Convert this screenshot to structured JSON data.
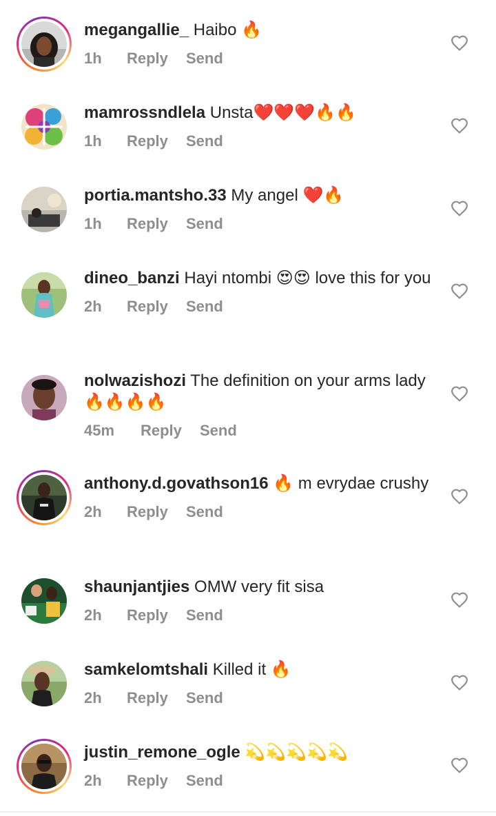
{
  "comments": [
    {
      "username": "megangallie_",
      "text": "Haibo 🔥",
      "time": "1h",
      "reply": "Reply",
      "send": "Send",
      "story_ring": true
    },
    {
      "username": "mamrossndlela",
      "text": "Unsta❤️❤️❤️🔥🔥",
      "time": "1h",
      "reply": "Reply",
      "send": "Send",
      "story_ring": false
    },
    {
      "username": "portia.mantsho.33",
      "text": "My angel ❤️🔥",
      "time": "1h",
      "reply": "Reply",
      "send": "Send",
      "story_ring": false
    },
    {
      "username": "dineo_banzi",
      "text": "Hayi ntombi 😍😍 love this for you",
      "time": "2h",
      "reply": "Reply",
      "send": "Send",
      "story_ring": false
    },
    {
      "username": "nolwazishozi",
      "text": "The definition on your arms lady🔥🔥🔥🔥",
      "time": "45m",
      "reply": "Reply",
      "send": "Send",
      "story_ring": false
    },
    {
      "username": "anthony.d.govathson16",
      "text": "🔥 m evrydae crushy",
      "time": "2h",
      "reply": "Reply",
      "send": "Send",
      "story_ring": true
    },
    {
      "username": "shaunjantjies",
      "text": "OMW very fit sisa",
      "time": "2h",
      "reply": "Reply",
      "send": "Send",
      "story_ring": false
    },
    {
      "username": "samkelomtshali",
      "text": "Killed it 🔥",
      "time": "2h",
      "reply": "Reply",
      "send": "Send",
      "story_ring": false
    },
    {
      "username": "justin_remone_ogle",
      "text": "💫💫💫💫💫",
      "time": "2h",
      "reply": "Reply",
      "send": "Send",
      "story_ring": true
    }
  ],
  "icons": {
    "like": "heart-outline-icon"
  },
  "colors": {
    "text": "#262626",
    "meta": "#8e8e8e",
    "heart": "#8e8e8e"
  }
}
